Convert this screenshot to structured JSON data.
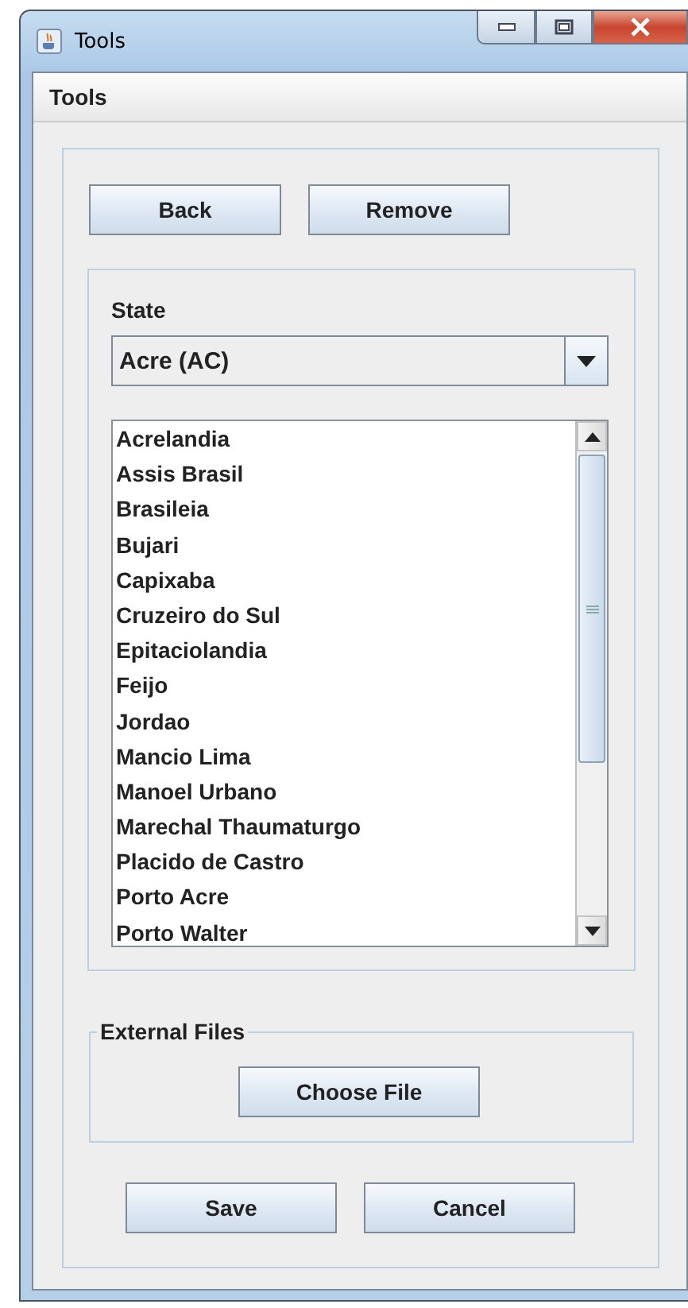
{
  "window": {
    "title": "Tools"
  },
  "menu_bar": [
    "Tools"
  ],
  "top_buttons": [
    "Back",
    "Remove"
  ],
  "state": {
    "label": "State",
    "value": "Acre (AC)"
  },
  "cities": [
    {
      "name": "Acrelandia",
      "selected": false
    },
    {
      "name": "Assis Brasil",
      "selected": false
    },
    {
      "name": "Brasileia",
      "selected": false
    },
    {
      "name": "Bujari",
      "selected": false
    },
    {
      "name": "Capixaba",
      "selected": false
    },
    {
      "name": "Cruzeiro do Sul",
      "selected": false
    },
    {
      "name": "Epitaciolandia",
      "selected": false
    },
    {
      "name": "Feijo",
      "selected": false
    },
    {
      "name": "Jordao",
      "selected": false
    },
    {
      "name": "Mancio Lima",
      "selected": false
    },
    {
      "name": "Manoel Urbano",
      "selected": false
    },
    {
      "name": "Marechal Thaumaturgo",
      "selected": false
    },
    {
      "name": "Placido de Castro",
      "selected": false
    },
    {
      "name": "Porto Acre",
      "selected": false
    },
    {
      "name": "Porto Walter",
      "selected": false
    }
  ],
  "external_files": {
    "title": "External Files",
    "button": "Choose File"
  },
  "bottom_buttons": [
    "Save",
    "Cancel"
  ]
}
